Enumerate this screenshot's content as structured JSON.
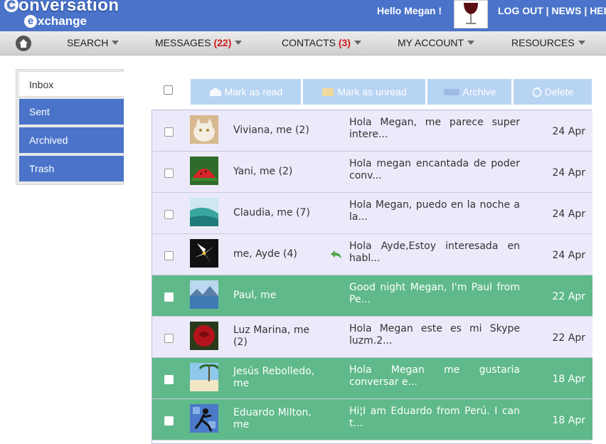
{
  "header": {
    "logo_line1": "onversation",
    "logo_cap": "C",
    "logo_e": "e",
    "logo_line2": "xchange",
    "greeting": "Hello Megan !",
    "links": [
      "LOG OUT",
      "NEWS",
      "HEL"
    ],
    "brand_color": "#4a73c9"
  },
  "nav": {
    "home_icon": "home-icon",
    "items": [
      {
        "label": "SEARCH",
        "count": ""
      },
      {
        "label": "MESSAGES",
        "count": "(22)"
      },
      {
        "label": "CONTACTS",
        "count": "(3)"
      },
      {
        "label": "MY ACCOUNT",
        "count": ""
      },
      {
        "label": "RESOURCES",
        "count": ""
      }
    ]
  },
  "sidebar": {
    "items": [
      "Inbox",
      "Sent",
      "Archived",
      "Trash"
    ],
    "active": "Inbox"
  },
  "toolbar": {
    "mark_read": "Mark as read",
    "mark_unread": "Mark as unread",
    "archive": "Archive",
    "delete": "Delete"
  },
  "messages": [
    {
      "from": "Viviana, me  (2)",
      "snippet": "Hola Megan, me parece super intere...",
      "date": "24 Apr",
      "unread": false,
      "thumb": "cat"
    },
    {
      "from": "Yani, me  (2)",
      "snippet": "Hola megan encantada de poder conv...",
      "date": "24 Apr",
      "unread": false,
      "thumb": "watermelon"
    },
    {
      "from": "Claudia, me  (7)",
      "snippet": "Hola Megan, puedo en la noche a la...",
      "date": "24 Apr",
      "unread": false,
      "thumb": "wave"
    },
    {
      "from": "me, Ayde  (4)",
      "snippet": "Hola Ayde,Estoy interesada en habl...",
      "date": "24 Apr",
      "unread": false,
      "thumb": "lily",
      "replied": true
    },
    {
      "from": "Paul, me",
      "snippet": "Good night Megan, I'm Paul from Pe...",
      "date": "22 Apr",
      "unread": true,
      "thumb": "lake"
    },
    {
      "from": "Luz Marina, me  (2)",
      "snippet": "Hola Megan este es mi Skype luzm.2...",
      "date": "22 Apr",
      "unread": false,
      "thumb": "rose"
    },
    {
      "from": "Jesús Rebolledo, me",
      "snippet": "Hola Megan me gustaria conversar e...",
      "date": "18 Apr",
      "unread": true,
      "thumb": "beach"
    },
    {
      "from": "Eduardo Milton, me",
      "snippet": "Hi¦I am Eduardo from Perú. I can t...",
      "date": "18 Apr",
      "unread": true,
      "thumb": "runner"
    }
  ]
}
